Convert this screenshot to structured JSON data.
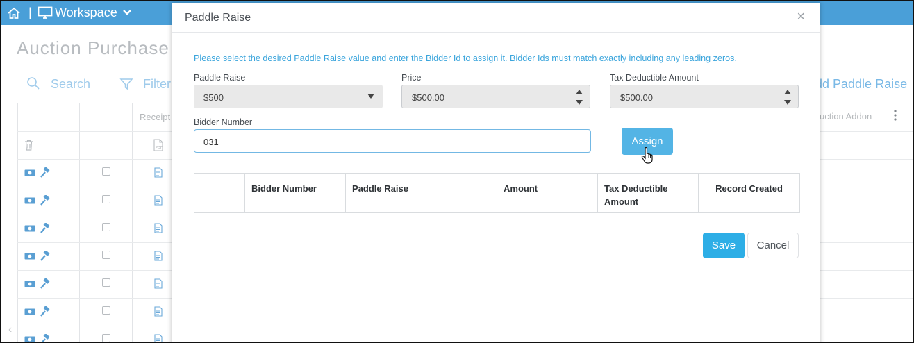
{
  "topbar": {
    "separator": "|",
    "workspace_label": "Workspace",
    "icons": [
      "home-icon",
      "monitor-icon",
      "chevron-down-icon"
    ]
  },
  "background": {
    "page_title": "Auction Purchase",
    "search_label": "Search",
    "filter_label": "Filter",
    "add_paddle_raise_label": "dd Paddle Raise",
    "receipt_header": "Receipt",
    "auction_addon_header": "uction Addon",
    "left_scroll_arrow": "‹"
  },
  "modal": {
    "title": "Paddle Raise",
    "close_glyph": "×",
    "info_text": "Please select the desired Paddle Raise value and enter the Bidder Id to assign it. Bidder Ids must match exactly including any leading zeros.",
    "paddle_raise": {
      "label": "Paddle Raise",
      "value": "$500"
    },
    "price": {
      "label": "Price",
      "value": "$500.00"
    },
    "tax_deductible": {
      "label": "Tax Deductible Amount",
      "value": "$500.00"
    },
    "bidder_number": {
      "label": "Bidder Number",
      "value": "031"
    },
    "assign_label": "Assign",
    "table": {
      "columns": [
        "",
        "Bidder Number",
        "Paddle Raise",
        "Amount",
        "Tax Deductible Amount",
        "Record Created"
      ],
      "rows": []
    },
    "save_label": "Save",
    "cancel_label": "Cancel"
  },
  "colors": {
    "accent": "#2daee6",
    "topbar": "#4a9fd8",
    "info_text": "#3ba5dc"
  }
}
